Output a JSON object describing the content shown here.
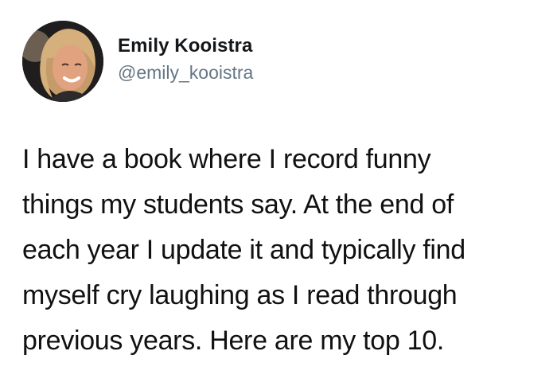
{
  "tweet": {
    "author": {
      "display_name": "Emily Kooistra",
      "handle": "@emily_kooistra",
      "avatar_icon": "profile-photo"
    },
    "text_lines": [
      "I have a book where I record funny",
      "things my students say. At the end of",
      "each year I update it and typically find",
      "myself cry laughing as I read through",
      "previous years. Here are my top 10."
    ]
  }
}
